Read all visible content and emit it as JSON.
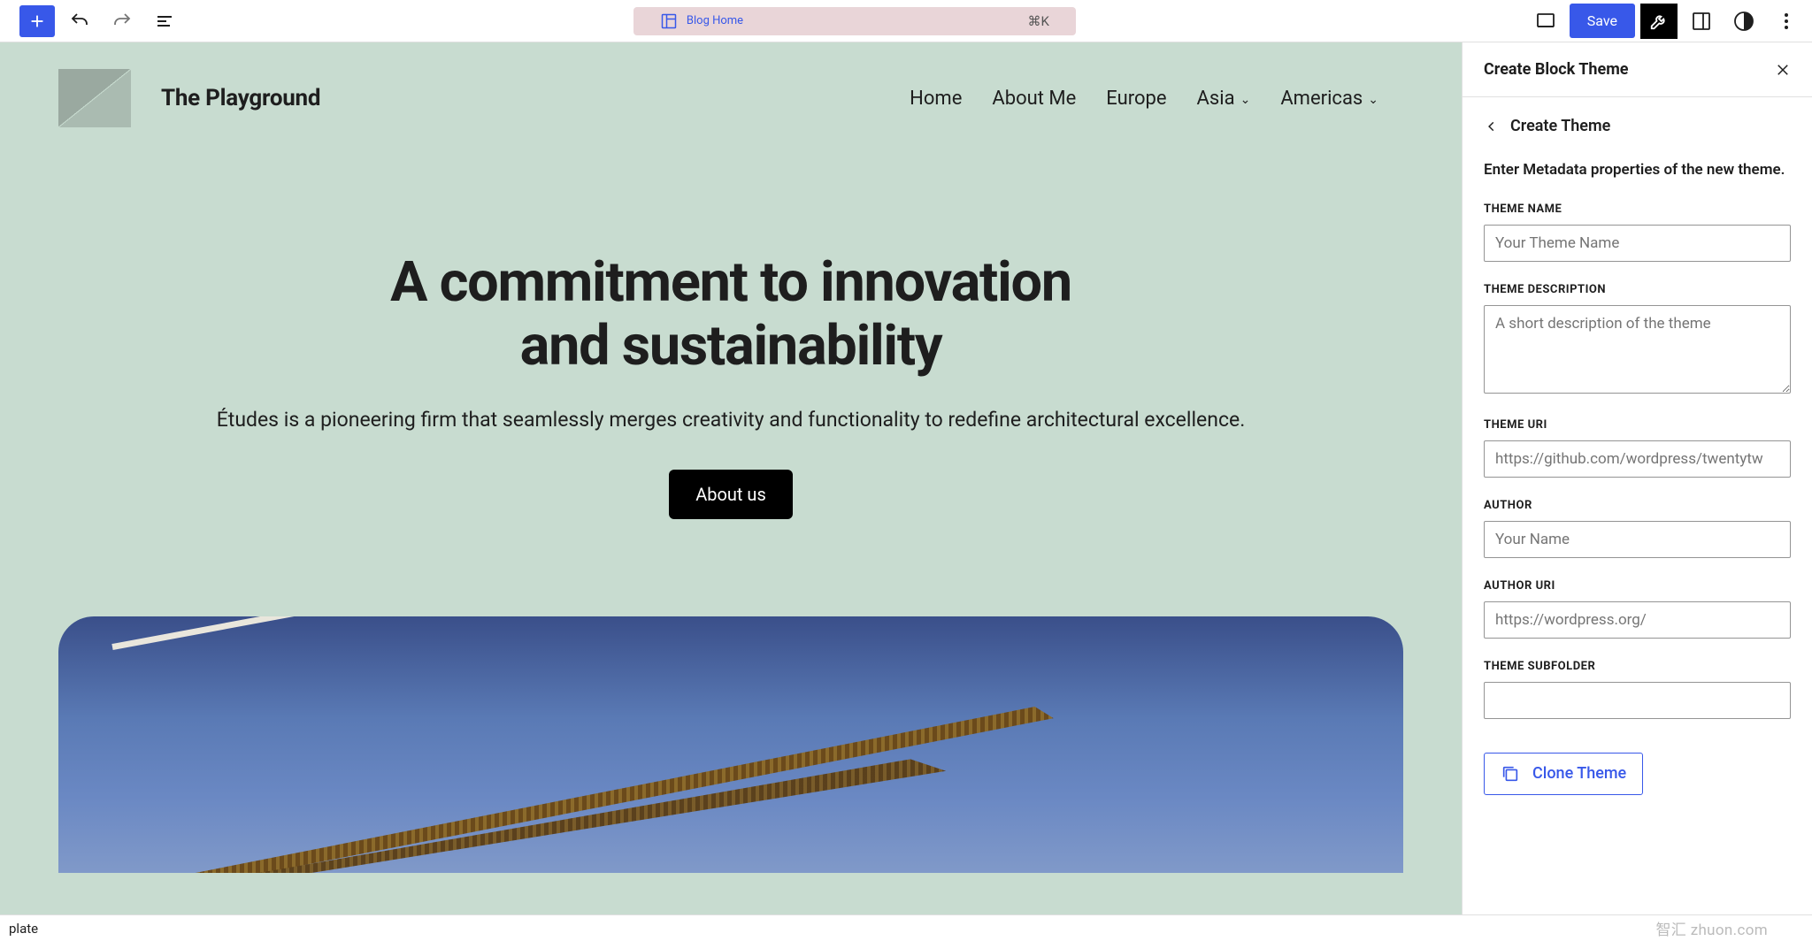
{
  "toolbar": {
    "template_label": "Blog Home",
    "shortcut": "⌘K",
    "save_label": "Save"
  },
  "site": {
    "title": "The Playground",
    "nav": [
      "Home",
      "About Me",
      "Europe",
      "Asia",
      "Americas"
    ]
  },
  "hero": {
    "title_line1": "A commitment to innovation",
    "title_line2": "and sustainability",
    "subtitle": "Études is a pioneering firm that seamlessly merges creativity and functionality to redefine architectural excellence.",
    "cta": "About us"
  },
  "sidebar": {
    "panel_title": "Create Block Theme",
    "back_label": "Create Theme",
    "intro": "Enter Metadata properties of the new theme.",
    "fields": {
      "name_label": "THEME NAME",
      "name_ph": "Your Theme Name",
      "desc_label": "THEME DESCRIPTION",
      "desc_ph": "A short description of the theme",
      "uri_label": "THEME URI",
      "uri_ph": "https://github.com/wordpress/twentytw",
      "author_label": "AUTHOR",
      "author_ph": "Your Name",
      "auri_label": "AUTHOR URI",
      "auri_ph": "https://wordpress.org/",
      "subf_label": "THEME SUBFOLDER"
    },
    "clone_label": "Clone Theme"
  },
  "footer": {
    "left_text": "plate",
    "watermark": "智汇 zhuon.com"
  }
}
